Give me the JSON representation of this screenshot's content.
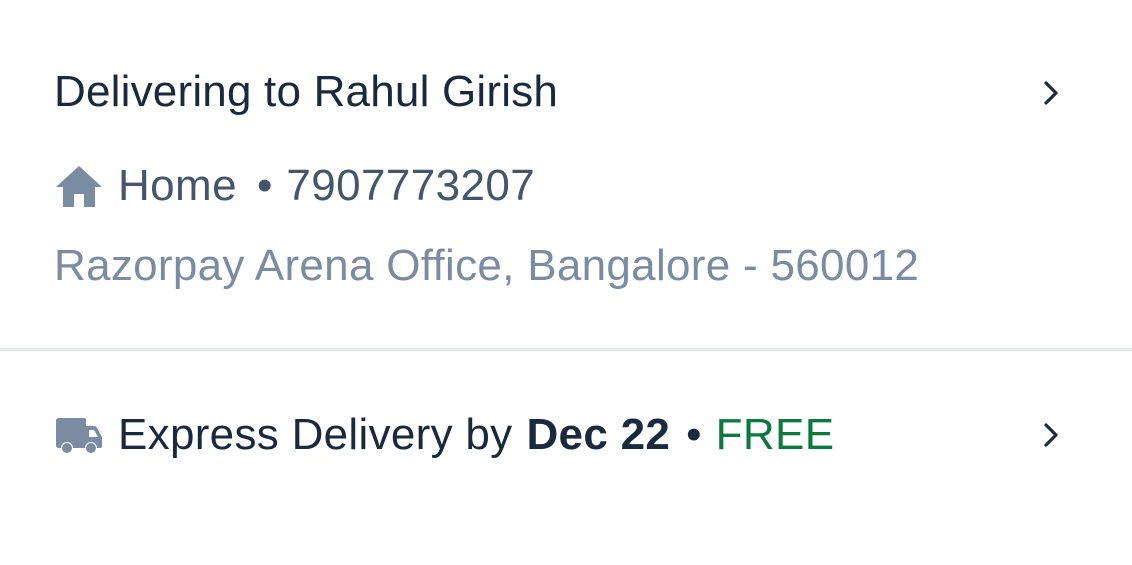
{
  "address": {
    "title": "Delivering to Rahul Girish",
    "label": "Home",
    "separator": "•",
    "phone": "7907773207",
    "full_address": "Razorpay Arena Office, Bangalore - 560012",
    "icon": "home-icon"
  },
  "delivery": {
    "text": "Express Delivery by",
    "date": "Dec 22",
    "separator": "•",
    "price": "FREE",
    "icon": "truck-icon"
  },
  "colors": {
    "title": "#192a3e",
    "secondary": "#43566b",
    "muted": "#7a8ca2",
    "icon": "#7a8ca2",
    "free": "#0b7a3e",
    "divider": "#e6eaef"
  }
}
